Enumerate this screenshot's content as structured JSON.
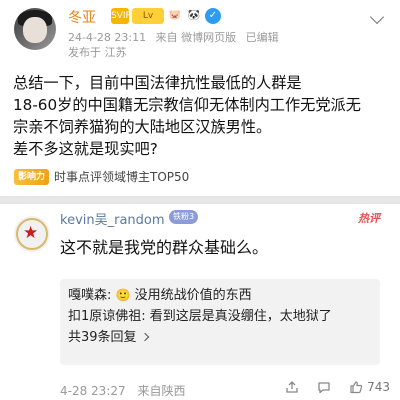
{
  "post": {
    "username": "冬亚",
    "badges": {
      "vip": "SVIP",
      "level": "Lv",
      "pig": "🐷",
      "panda": "🐼",
      "blue": "✓"
    },
    "timestamp": "24-4-28 23:11",
    "source": "来自 微博网页版",
    "edited": "已编辑",
    "location": "发布于 江苏",
    "text_lines": [
      "总结一下，目前中国法律抗性最低的人群是",
      "18-60岁的中国籍无宗教信仰无体制内工作无党派无",
      "宗亲不饲养猫狗的大陆地区汉族男性。",
      "差不多这就是现实吧?"
    ],
    "influence": {
      "badge": "影响力",
      "text": "时事点评领域博主TOP50"
    }
  },
  "comment": {
    "username": "kevin吴_random",
    "fan_badge": "铁粉3",
    "hot_label": "热评",
    "text": "这不就是我党的群众基础么。",
    "replies": [
      {
        "user": "嘎噗森:",
        "emoji": "🙂",
        "text": "没用统战价值的东西"
      },
      {
        "user": "扣1原谅佛祖:",
        "emoji": "",
        "text": "看到这层是真没绷住，太地狱了"
      }
    ],
    "more_replies": "共39条回复",
    "time": "4-28 23:27",
    "location": "来自陕西",
    "likes": "743"
  },
  "colors": {
    "username_orange": "#e5861c",
    "username_blue": "#5b7a9e",
    "hot_red": "#e35353",
    "meta_gray": "#9a9a9a"
  },
  "icons": [
    "chevron-down-icon",
    "share-icon",
    "comment-icon",
    "like-icon"
  ]
}
